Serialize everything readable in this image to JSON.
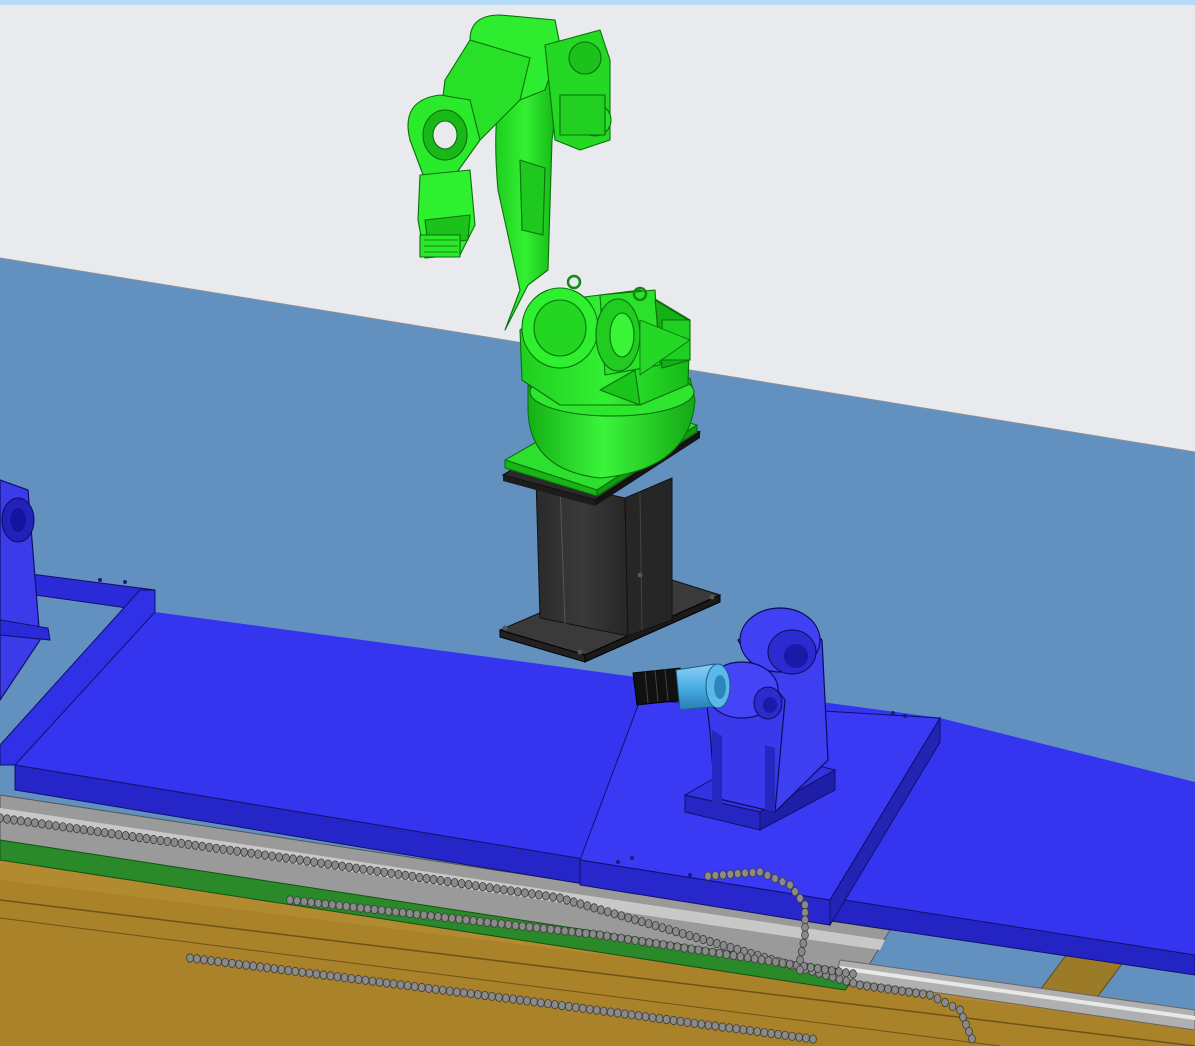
{
  "viewport": {
    "kind": "3d-cad-viewport",
    "colors": {
      "top_strip": "#b4dcf6",
      "backdrop": "#e9eaee",
      "floor": "#6291c0",
      "robot": "#22dd22",
      "robot_dark": "#0b7a0b",
      "pedestal": "#2f2f2f",
      "slide_table": "#3333ee",
      "positioner": "#3b3bea",
      "track_frame": "#b28a2f",
      "rail": "#9a9a9a",
      "pcb_strip": "#2a8a2a",
      "cable_chain": "#7b7b7b",
      "motor": "#111111",
      "coupling": "#49aee6"
    },
    "objects": [
      {
        "name": "industrial-robot-arm",
        "color_key": "robot"
      },
      {
        "name": "robot-pedestal",
        "color_key": "pedestal"
      },
      {
        "name": "linear-track",
        "color_key": "track_frame"
      },
      {
        "name": "slide-table",
        "color_key": "slide_table"
      },
      {
        "name": "headstock-positioner",
        "color_key": "positioner"
      },
      {
        "name": "tailstock-positioner",
        "color_key": "positioner"
      },
      {
        "name": "servo-motor",
        "color_key": "motor"
      },
      {
        "name": "cable-chain",
        "color_key": "cable_chain"
      }
    ]
  }
}
